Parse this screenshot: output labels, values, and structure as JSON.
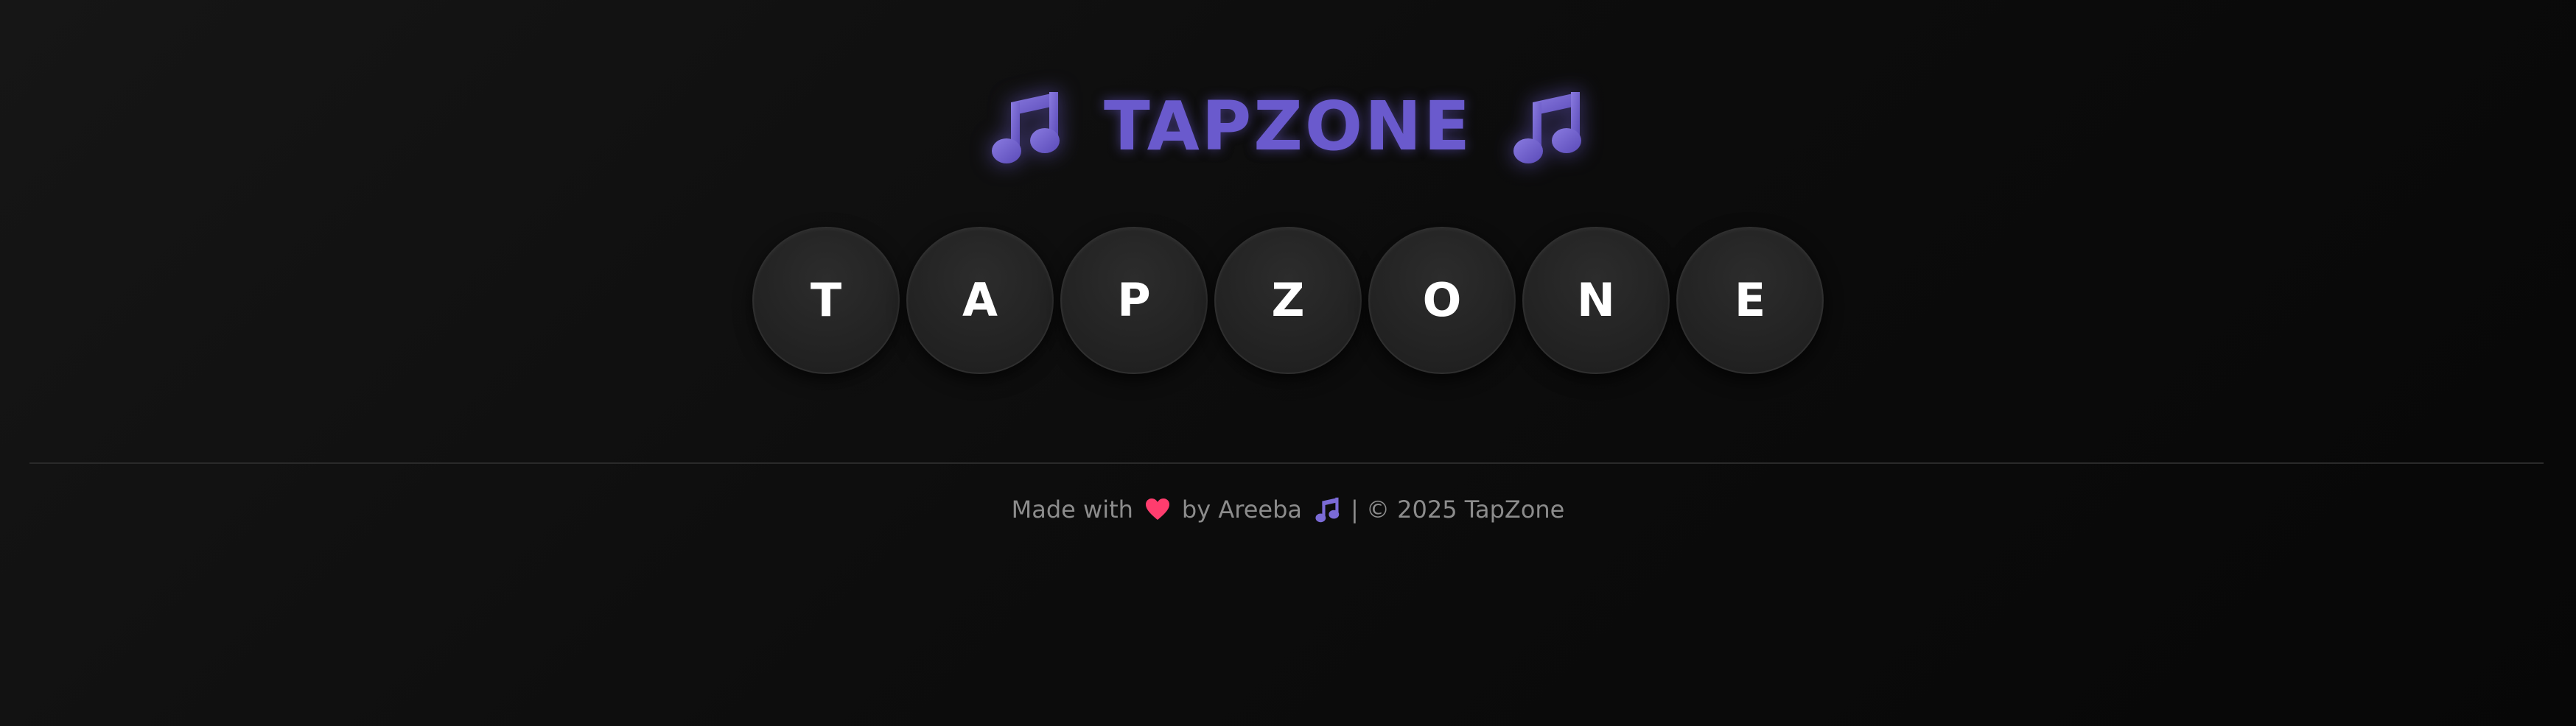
{
  "app": {
    "title": "TAPZONE",
    "accent_color": "#6a5acd",
    "title_icon": "music-notes-icon"
  },
  "pads": [
    {
      "label": "T"
    },
    {
      "label": "A"
    },
    {
      "label": "P"
    },
    {
      "label": "Z"
    },
    {
      "label": "O"
    },
    {
      "label": "N"
    },
    {
      "label": "E"
    }
  ],
  "footer": {
    "made_with": "Made with",
    "heart_icon": "heart-icon",
    "heart_color": "#ff3d6e",
    "by_author": "by Areeba",
    "note_icon": "music-notes-icon",
    "copyright": "| © 2025 TapZone"
  }
}
